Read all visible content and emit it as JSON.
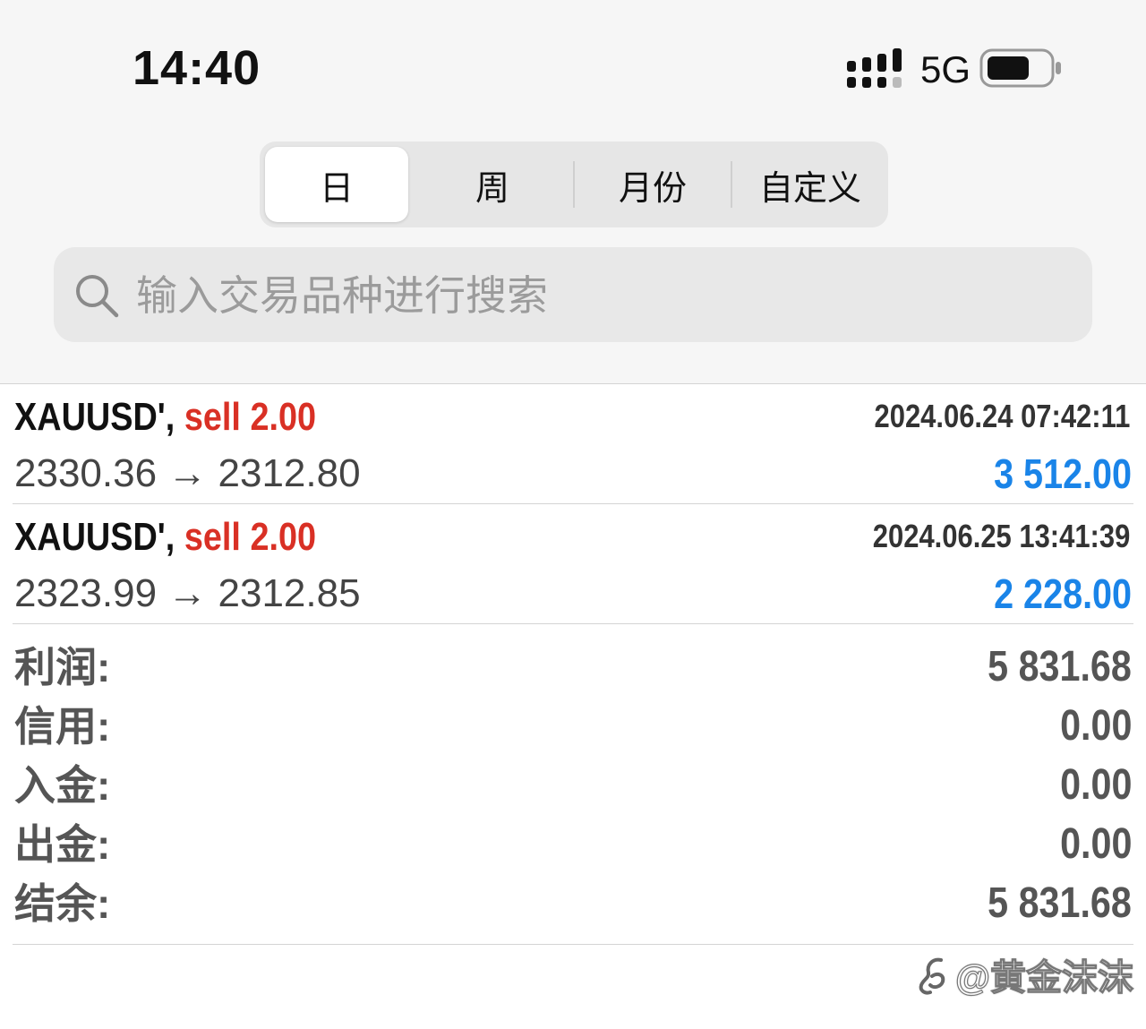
{
  "status_bar": {
    "time": "14:40",
    "network": "5G",
    "signal_icon": "signal-bars-icon",
    "battery_icon": "battery-icon"
  },
  "period_tabs": [
    {
      "label": "日",
      "selected": true
    },
    {
      "label": "周",
      "selected": false
    },
    {
      "label": "月份",
      "selected": false
    },
    {
      "label": "自定义",
      "selected": false
    }
  ],
  "search": {
    "placeholder": "输入交易品种进行搜索",
    "value": ""
  },
  "trades": [
    {
      "symbol": "XAUUSD',",
      "side": "sell 2.00",
      "time": "2024.06.24 07:42:11",
      "prices": "2330.36 → 2312.80",
      "profit": "3 512.00"
    },
    {
      "symbol": "XAUUSD',",
      "side": "sell 2.00",
      "time": "2024.06.25 13:41:39",
      "prices": "2323.99 → 2312.85",
      "profit": "2 228.00"
    }
  ],
  "summary": [
    {
      "label": "利润:",
      "value": "5 831.68"
    },
    {
      "label": "信用:",
      "value": "0.00"
    },
    {
      "label": "入金:",
      "value": "0.00"
    },
    {
      "label": "出金:",
      "value": "0.00"
    },
    {
      "label": "结余:",
      "value": "5 831.68"
    }
  ],
  "watermark": {
    "text": "@黄金沫沫",
    "logo_icon": "weibo-logo-icon"
  },
  "colors": {
    "sell": "#d93025",
    "profit": "#1a84e8",
    "background_top": "#f6f6f6"
  }
}
